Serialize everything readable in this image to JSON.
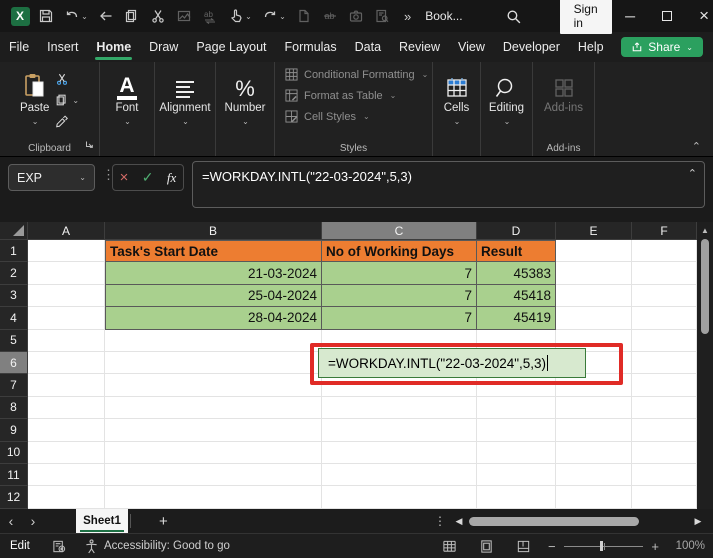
{
  "titlebar": {
    "workbook_name": "Book...",
    "sign_in_label": "Sign in",
    "more_commands": "»"
  },
  "menubar": {
    "tabs": [
      {
        "label": "File"
      },
      {
        "label": "Insert"
      },
      {
        "label": "Home",
        "active": true
      },
      {
        "label": "Draw"
      },
      {
        "label": "Page Layout"
      },
      {
        "label": "Formulas"
      },
      {
        "label": "Data"
      },
      {
        "label": "Review"
      },
      {
        "label": "View"
      },
      {
        "label": "Developer"
      },
      {
        "label": "Help"
      }
    ],
    "share_label": "Share"
  },
  "ribbon": {
    "paste_label": "Paste",
    "clipboard_group_label": "Clipboard",
    "font_label": "Font",
    "alignment_label": "Alignment",
    "number_label": "Number",
    "number_icon_glyph": "%",
    "styles_items": [
      "Conditional Formatting",
      "Format as Table",
      "Cell Styles"
    ],
    "styles_group_label": "Styles",
    "cells_label": "Cells",
    "editing_label": "Editing",
    "addins_label": "Add-ins",
    "addins_group_label": "Add-ins"
  },
  "formula_bar": {
    "name_box": "EXP",
    "fx_label": "fx",
    "formula": "=WORKDAY.INTL(\"22-03-2024\",5,3)"
  },
  "grid": {
    "columns": [
      "A",
      "B",
      "C",
      "D",
      "E",
      "F"
    ],
    "active_column": "C",
    "active_row": 6,
    "row_count": 12,
    "table": {
      "header_row": [
        "Task's Start Date",
        "No of Working Days",
        "Result"
      ],
      "rows": [
        [
          "21-03-2024",
          "7",
          "45383"
        ],
        [
          "25-04-2024",
          "7",
          "45418"
        ],
        [
          "28-04-2024",
          "7",
          "45419"
        ]
      ]
    },
    "cells": [
      {
        "ref": "B1",
        "text": "Task's Start Date",
        "type": "header"
      },
      {
        "ref": "C1",
        "text": "No of Working Days",
        "type": "header"
      },
      {
        "ref": "D1",
        "text": "Result",
        "type": "header"
      },
      {
        "ref": "B2",
        "text": "21-03-2024",
        "type": "data"
      },
      {
        "ref": "C2",
        "text": "7",
        "type": "data"
      },
      {
        "ref": "D2",
        "text": "45383",
        "type": "data"
      },
      {
        "ref": "B3",
        "text": "25-04-2024",
        "type": "data"
      },
      {
        "ref": "C3",
        "text": "7",
        "type": "data"
      },
      {
        "ref": "D3",
        "text": "45418",
        "type": "data"
      },
      {
        "ref": "B4",
        "text": "28-04-2024",
        "type": "data"
      },
      {
        "ref": "C4",
        "text": "7",
        "type": "data"
      },
      {
        "ref": "D4",
        "text": "45419",
        "type": "data"
      }
    ],
    "edit_cell": {
      "ref": "C6",
      "text": "=WORKDAY.INTL(\"22-03-2024\",5,3)"
    }
  },
  "sheet_bar": {
    "tabs": [
      {
        "label": "Sheet1",
        "active": true
      }
    ],
    "add_sheet_glyph": "+"
  },
  "status_bar": {
    "mode": "Edit",
    "accessibility": "Accessibility: Good to go",
    "zoom_level": "100%"
  },
  "colors": {
    "header_fill": "#ED7D31",
    "data_fill": "#A9D08E",
    "edit_fill": "#D7E9CF",
    "annotation_red": "#E02B26",
    "accent_green": "#2BA05F"
  }
}
